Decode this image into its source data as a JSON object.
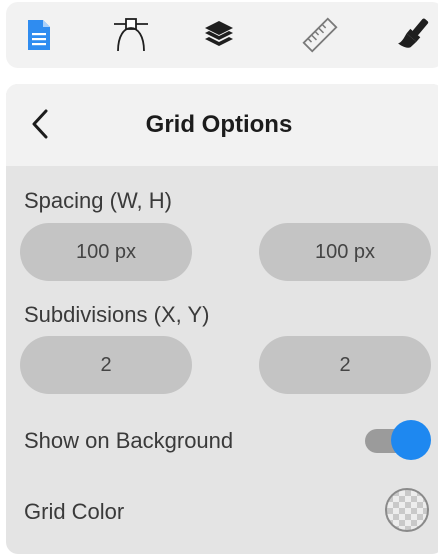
{
  "toolbar": {
    "tools": [
      {
        "icon": "document-icon",
        "active": true
      },
      {
        "icon": "bezier-pen-icon",
        "active": false
      },
      {
        "icon": "layers-icon",
        "active": false
      },
      {
        "icon": "ruler-icon",
        "active": false
      },
      {
        "icon": "paint-brush-icon",
        "active": false
      }
    ]
  },
  "panel": {
    "title": "Grid Options",
    "back_icon": "chevron-left-icon",
    "spacing": {
      "label": "Spacing (W, H)",
      "width_value": "100 px",
      "height_value": "100 px"
    },
    "subdivisions": {
      "label": "Subdivisions (X, Y)",
      "x_value": "2",
      "y_value": "2"
    },
    "show_on_background": {
      "label": "Show on Background",
      "enabled": true
    },
    "grid_color": {
      "label": "Grid Color",
      "swatch": "transparent-checkerboard"
    }
  },
  "colors": {
    "accent": "#1e88f0",
    "panel_bg": "#e4e4e4",
    "header_bg": "#f2f2f2",
    "field_bg": "#c4c4c4",
    "icon": "#1f1f1f"
  }
}
